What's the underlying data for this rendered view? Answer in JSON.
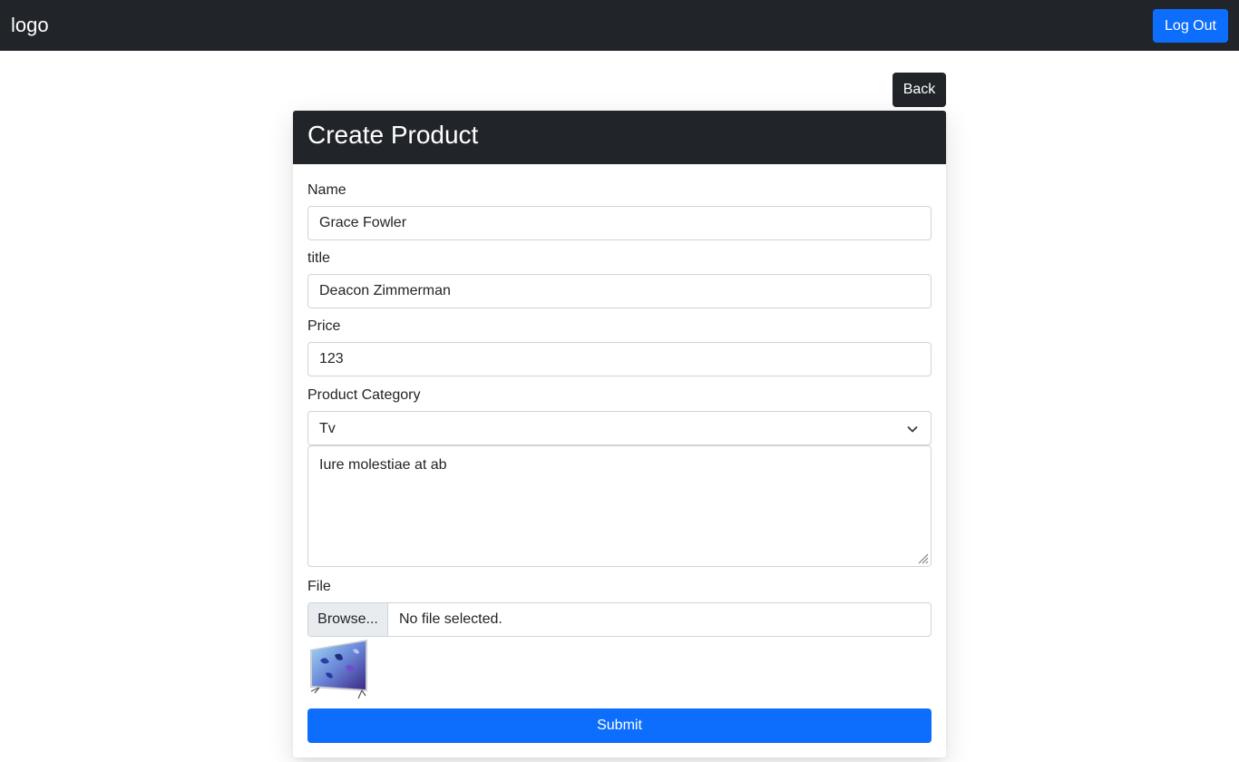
{
  "navbar": {
    "logo": "logo",
    "logout_label": "Log Out"
  },
  "back_label": "Back",
  "card": {
    "title": "Create Product"
  },
  "form": {
    "name": {
      "label": "Name",
      "value": "Grace Fowler"
    },
    "title": {
      "label": "title",
      "value": "Deacon Zimmerman"
    },
    "price": {
      "label": "Price",
      "value": "123"
    },
    "category": {
      "label": "Product Category",
      "selected": "Tv"
    },
    "description": {
      "value": "Iure molestiae at ab"
    },
    "file": {
      "label": "File",
      "browse_label": "Browse...",
      "status": "No file selected."
    },
    "preview_image": "tv-product-thumbnail",
    "submit_label": "Submit"
  },
  "colors": {
    "dark": "#212529",
    "primary": "#0d6efd",
    "border": "#ced4da"
  }
}
